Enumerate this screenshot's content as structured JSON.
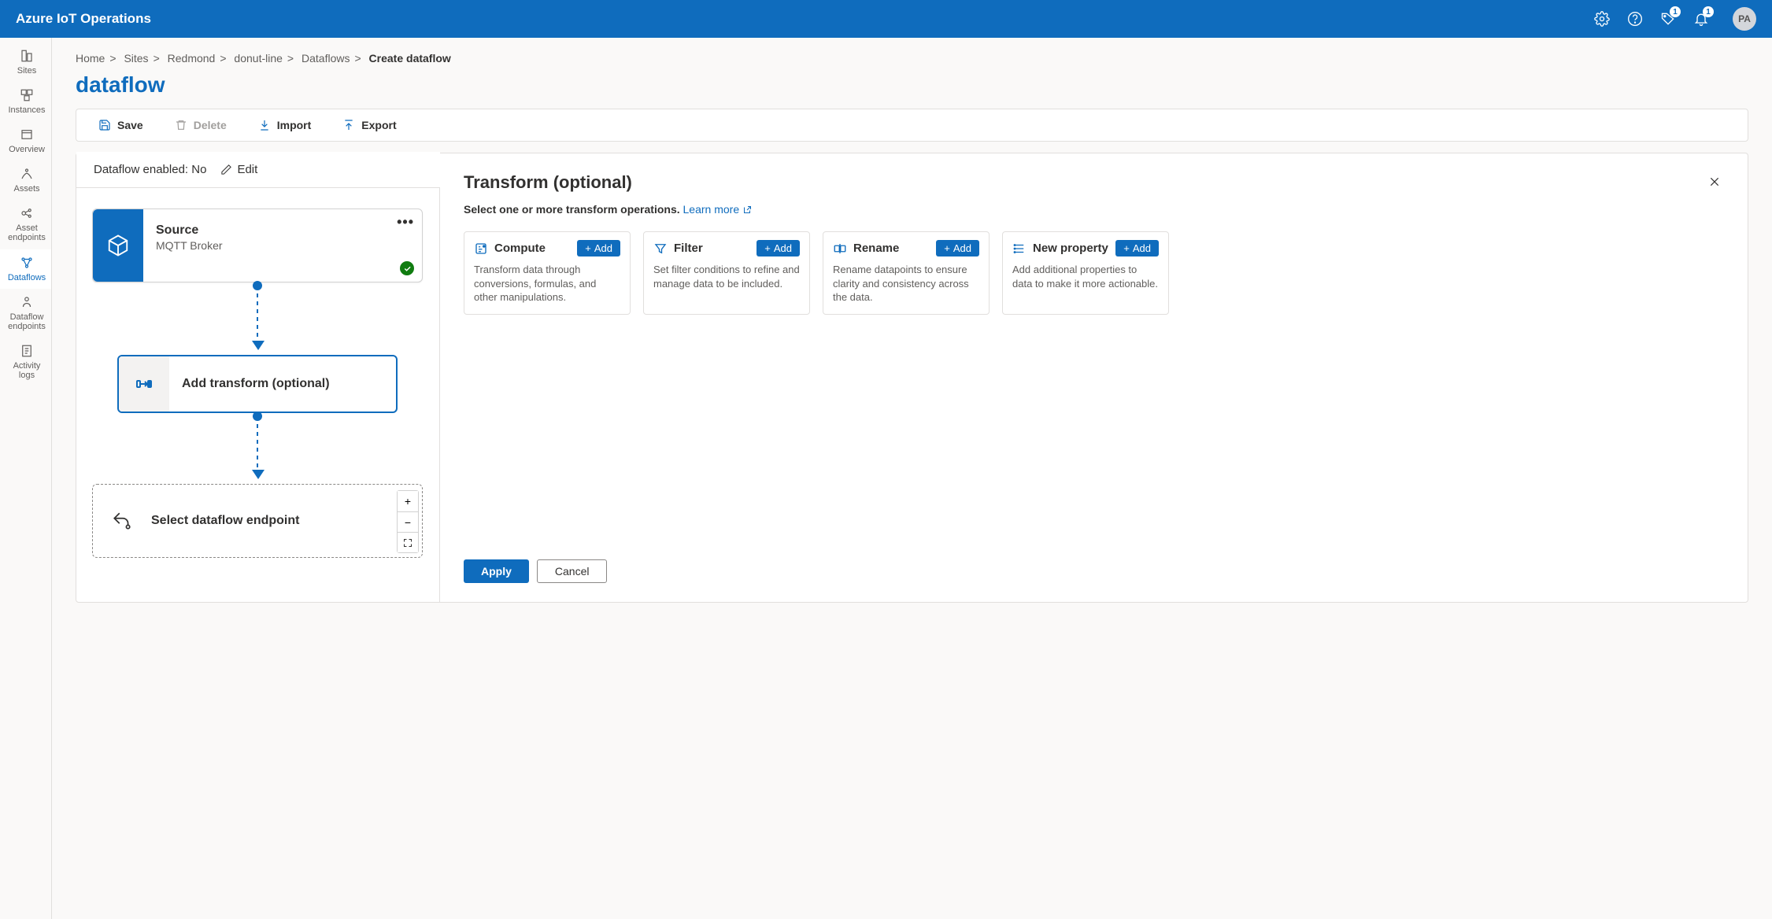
{
  "header": {
    "brand": "Azure IoT Operations",
    "notification_badge_1": "1",
    "notification_badge_2": "1",
    "avatar_initials": "PA"
  },
  "leftnav": {
    "items": [
      {
        "label": "Sites"
      },
      {
        "label": "Instances"
      },
      {
        "label": "Overview"
      },
      {
        "label": "Assets"
      },
      {
        "label": "Asset endpoints"
      },
      {
        "label": "Dataflows"
      },
      {
        "label": "Dataflow endpoints"
      },
      {
        "label": "Activity logs"
      }
    ]
  },
  "breadcrumbs": {
    "items": [
      "Home",
      "Sites",
      "Redmond",
      "donut-line",
      "Dataflows"
    ],
    "current": "Create dataflow"
  },
  "page_title": "dataflow",
  "toolbar": {
    "save": "Save",
    "delete": "Delete",
    "import": "Import",
    "export": "Export"
  },
  "enabled": {
    "label": "Dataflow enabled:",
    "value": "No",
    "edit": "Edit"
  },
  "nodes": {
    "source": {
      "title": "Source",
      "subtitle": "MQTT Broker"
    },
    "transform": {
      "title": "Add transform (optional)"
    },
    "endpoint": {
      "title": "Select dataflow endpoint"
    }
  },
  "right_panel": {
    "title": "Transform (optional)",
    "subtitle": "Select one or more transform operations.",
    "learn_more": "Learn more",
    "add_label": "Add",
    "cards": [
      {
        "title": "Compute",
        "desc": "Transform data through conversions, formulas, and other manipulations."
      },
      {
        "title": "Filter",
        "desc": "Set filter conditions to refine and manage data to be included."
      },
      {
        "title": "Rename",
        "desc": "Rename datapoints to ensure clarity and consistency across the data."
      },
      {
        "title": "New property",
        "desc": "Add additional properties to data to make it more actionable."
      }
    ],
    "apply": "Apply",
    "cancel": "Cancel"
  }
}
